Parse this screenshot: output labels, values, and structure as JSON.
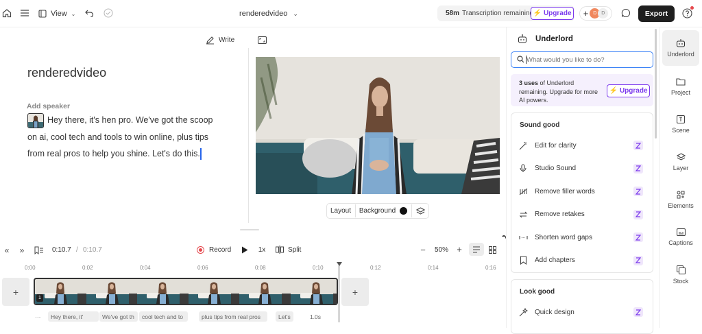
{
  "topbar": {
    "view_label": "View",
    "title": "renderedvideo",
    "transcription_time": "58m",
    "transcription_label": "Transcription remaining",
    "upgrade_label": "Upgrade",
    "avatar_initial": "D",
    "avatar2_initial": "D",
    "export_label": "Export"
  },
  "editor": {
    "write_label": "Write",
    "doc_title": "renderedvideo",
    "add_speaker": "Add speaker",
    "script_lines": [
      "Hey there, it's hen pro. We've got the scoop",
      "on ai, cool tech and tools to win online, plus tips",
      "from real pros to help you shine. Let's do this."
    ]
  },
  "canvas": {
    "layout_label": "Layout",
    "background_label": "Background",
    "background_color": "#111111"
  },
  "timeline": {
    "current_time": "0:10.7",
    "separator": "/",
    "total_time": "0:10.7",
    "record_label": "Record",
    "speed_label": "1x",
    "split_label": "Split",
    "zoom_label": "50%",
    "ticks": [
      "0:00",
      "0:02",
      "0:04",
      "0:06",
      "0:08",
      "0:10",
      "0:12",
      "0:14",
      "0:16"
    ],
    "clip_badge": "1",
    "word_chips": [
      "···",
      "Hey there, it'",
      "We've got th",
      "cool tech and to",
      "plus tips from real pros",
      "Let's",
      "1.0s"
    ]
  },
  "underlord": {
    "title": "Underlord",
    "search_placeholder": "What would you like to do?",
    "uses_bold": "3 uses",
    "uses_text": "of Underlord remaining. Upgrade for more AI powers.",
    "upgrade_label": "Upgrade",
    "sound_good": {
      "heading": "Sound good",
      "actions": [
        "Edit for clarity",
        "Studio Sound",
        "Remove filler words",
        "Remove retakes",
        "Shorten word gaps",
        "Add chapters"
      ]
    },
    "look_good": {
      "heading": "Look good",
      "actions": [
        "Quick design"
      ]
    }
  },
  "sidenav": {
    "items": [
      "Underlord",
      "Project",
      "Scene",
      "Layer",
      "Elements",
      "Captions",
      "Stock"
    ]
  },
  "colors": {
    "accent": "#7c3aed",
    "record": "#e5484d",
    "search_border": "#3b82f6"
  }
}
